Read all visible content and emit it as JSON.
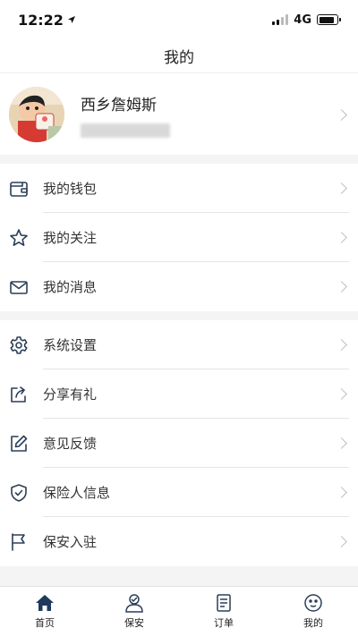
{
  "status_bar": {
    "time": "12:22",
    "network": "4G",
    "battery_level": 0.85
  },
  "nav": {
    "title": "我的"
  },
  "profile": {
    "name": "西乡詹姆斯"
  },
  "menu_group_1": [
    {
      "label": "我的钱包",
      "icon": "wallet-icon"
    },
    {
      "label": "我的关注",
      "icon": "star-icon"
    },
    {
      "label": "我的消息",
      "icon": "mail-icon"
    }
  ],
  "menu_group_2": [
    {
      "label": "系统设置",
      "icon": "gear-icon"
    },
    {
      "label": "分享有礼",
      "icon": "share-icon"
    },
    {
      "label": "意见反馈",
      "icon": "edit-icon"
    },
    {
      "label": "保险人信息",
      "icon": "shield-icon"
    },
    {
      "label": "保安入驻",
      "icon": "flag-icon"
    }
  ],
  "tabs": [
    {
      "label": "首页",
      "icon": "home-icon",
      "active": true
    },
    {
      "label": "保安",
      "icon": "guard-icon",
      "active": false
    },
    {
      "label": "订单",
      "icon": "order-icon",
      "active": false
    },
    {
      "label": "我的",
      "icon": "face-icon",
      "active": false
    }
  ],
  "colors": {
    "accent": "#1f3a5c",
    "divider": "#e5e5e5",
    "section_gap": "#f4f4f4",
    "icon": "#2c3e57"
  }
}
